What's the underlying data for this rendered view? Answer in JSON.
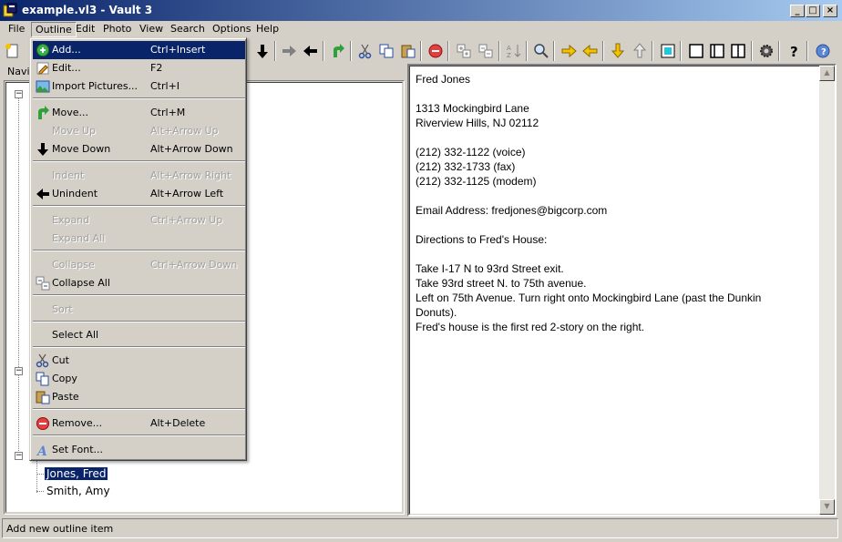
{
  "window": {
    "title": "example.vl3 - Vault 3",
    "buttons": {
      "minimize": "_",
      "maximize": "□",
      "close": "×"
    }
  },
  "menubar": [
    "File",
    "Outline",
    "Edit",
    "Photo",
    "View",
    "Search",
    "Options",
    "Help"
  ],
  "toolbar_icons": [
    "new-icon",
    "add-icon",
    "edit-icon",
    "arrow-up-icon",
    "arrow-down-icon",
    "arrow-right-gray-icon",
    "arrow-left-icon",
    "green-arrow-icon",
    "cut-icon",
    "copy-icon",
    "paste-icon",
    "remove-icon",
    "expand-icon",
    "collapse-icon",
    "sort-icon",
    "find-icon",
    "arrow-right-yellow-icon",
    "arrow-left-yellow-icon",
    "arrow-down-yellow-icon",
    "arrow-up-gray-icon",
    "cyan-square-icon",
    "layout-1-icon",
    "layout-2-icon",
    "layout-3-icon",
    "gear-icon",
    "help-icon",
    "info-icon"
  ],
  "left_pane": {
    "tab_label": "Navi",
    "tree_nodes": [
      {
        "label": "Jones, Fred",
        "selected": true
      },
      {
        "label": "Smith, Amy",
        "selected": false
      }
    ]
  },
  "note": {
    "lines": [
      "Fred Jones",
      "",
      "1313 Mockingbird Lane",
      "Riverview Hills, NJ  02112",
      "",
      "(212) 332-1122 (voice)",
      "(212) 332-1733 (fax)",
      "(212) 332-1125 (modem)",
      "",
      "Email Address:  fredjones@bigcorp.com",
      "",
      "Directions to Fred's House:",
      "",
      "Take I-17 N to 93rd Street exit.",
      "Take 93rd street N. to 75th avenue.",
      "Left on 75th Avenue.  Turn right onto Mockingbird Lane (past the Dunkin",
      "Donuts).",
      "Fred's house is the first red 2-story on the right."
    ]
  },
  "outline_menu": {
    "items": [
      {
        "label": "Add...",
        "shortcut": "Ctrl+Insert",
        "icon": "add-green-icon",
        "enabled": true,
        "highlighted": true
      },
      {
        "label": "Edit...",
        "shortcut": "F2",
        "icon": "edit-pencil-icon",
        "enabled": true
      },
      {
        "label": "Import Pictures...",
        "shortcut": "Ctrl+I",
        "icon": "picture-icon",
        "enabled": true
      },
      {
        "label": "Move...",
        "shortcut": "Ctrl+M",
        "icon": "green-arrow-icon",
        "enabled": true
      },
      {
        "label": "Move Up",
        "shortcut": "Alt+Arrow Up",
        "icon": "",
        "enabled": false
      },
      {
        "label": "Move Down",
        "shortcut": "Alt+Arrow Down",
        "icon": "arrow-down-icon",
        "enabled": true
      },
      {
        "label": "Indent",
        "shortcut": "Alt+Arrow Right",
        "icon": "",
        "enabled": false
      },
      {
        "label": "Unindent",
        "shortcut": "Alt+Arrow Left",
        "icon": "arrow-left-icon",
        "enabled": true
      },
      {
        "label": "Expand",
        "shortcut": "Ctrl+Arrow Up",
        "icon": "",
        "enabled": false
      },
      {
        "label": "Expand All",
        "shortcut": "",
        "icon": "",
        "enabled": false
      },
      {
        "label": "Collapse",
        "shortcut": "Ctrl+Arrow Down",
        "icon": "",
        "enabled": false
      },
      {
        "label": "Collapse All",
        "shortcut": "",
        "icon": "collapse-all-icon",
        "enabled": true
      },
      {
        "label": "Sort",
        "shortcut": "",
        "icon": "",
        "enabled": false
      },
      {
        "label": "Select All",
        "shortcut": "",
        "icon": "",
        "enabled": true
      },
      {
        "label": "Cut",
        "shortcut": "",
        "icon": "cut-icon",
        "enabled": true
      },
      {
        "label": "Copy",
        "shortcut": "",
        "icon": "copy-icon",
        "enabled": true
      },
      {
        "label": "Paste",
        "shortcut": "",
        "icon": "paste-icon",
        "enabled": true
      },
      {
        "label": "Remove...",
        "shortcut": "Alt+Delete",
        "icon": "remove-icon",
        "enabled": true
      },
      {
        "label": "Set Font...",
        "shortcut": "",
        "icon": "font-icon",
        "enabled": true
      }
    ]
  },
  "statusbar": {
    "text": "Add new outline item"
  },
  "colors": {
    "chrome": "#d4d0c8",
    "highlight": "#0a246a",
    "title_gradient_end": "#a6caf0",
    "disabled_text": "#a0a0a0"
  }
}
